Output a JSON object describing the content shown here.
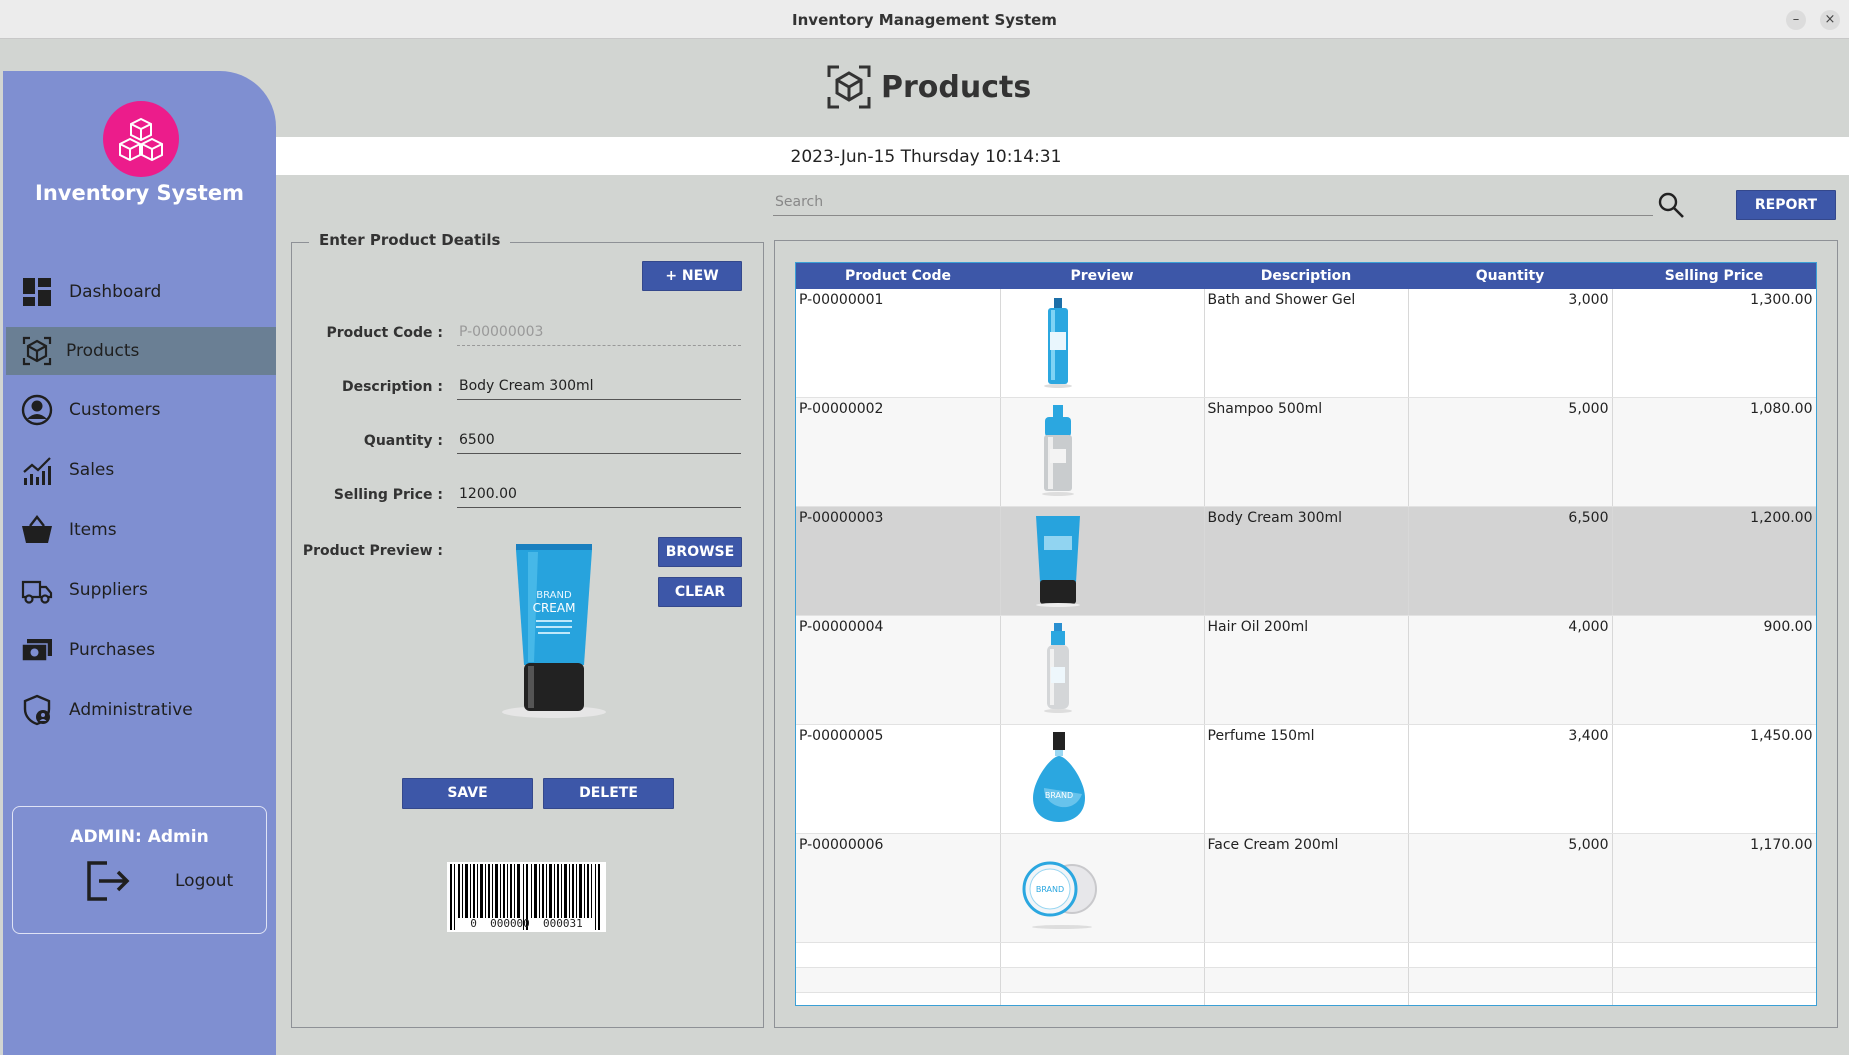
{
  "window": {
    "title": "Inventory Management System",
    "minimize": "–",
    "close": "×"
  },
  "sidebar": {
    "app_title": "Inventory System",
    "items": [
      {
        "label": "Dashboard",
        "icon": "dashboard-icon"
      },
      {
        "label": "Products",
        "icon": "box-icon",
        "active": true
      },
      {
        "label": "Customers",
        "icon": "user-circle-icon"
      },
      {
        "label": "Sales",
        "icon": "chart-icon"
      },
      {
        "label": "Items",
        "icon": "basket-icon"
      },
      {
        "label": "Suppliers",
        "icon": "truck-icon"
      },
      {
        "label": "Purchases",
        "icon": "money-icon"
      },
      {
        "label": "Administrative",
        "icon": "shield-user-icon"
      }
    ],
    "admin_label": "ADMIN: Admin",
    "logout_label": "Logout"
  },
  "header": {
    "title": "Products",
    "datetime": "2023-Jun-15 Thursday 10:14:31"
  },
  "search": {
    "placeholder": "Search"
  },
  "report_button": "REPORT",
  "form": {
    "legend": "Enter Product Deatils",
    "new_button": "+ NEW",
    "product_code_label": "Product Code :",
    "product_code_value": "P-00000003",
    "description_label": "Description :",
    "description_value": "Body Cream 300ml",
    "quantity_label": "Quantity :",
    "quantity_value": "6500",
    "selling_price_label": "Selling Price :",
    "selling_price_value": "1200.00",
    "preview_label": "Product Preview :",
    "browse_button": "BROWSE",
    "clear_button": "CLEAR",
    "save_button": "SAVE",
    "delete_button": "DELETE",
    "barcode_text": "0  000000  000031"
  },
  "table": {
    "headers": [
      "Product Code",
      "Preview",
      "Description",
      "Quantity",
      "Selling Price"
    ],
    "rows": [
      {
        "code": "P-00000001",
        "description": "Bath and Shower Gel",
        "quantity": "3,000",
        "price": "1,300.00",
        "preview": "tall-bottle"
      },
      {
        "code": "P-00000002",
        "description": "Shampoo 500ml",
        "quantity": "5,000",
        "price": "1,080.00",
        "preview": "shampoo-bottle"
      },
      {
        "code": "P-00000003",
        "description": "Body Cream 300ml",
        "quantity": "6,500",
        "price": "1,200.00",
        "preview": "cream-tube",
        "selected": true
      },
      {
        "code": "P-00000004",
        "description": "Hair Oil 200ml",
        "quantity": "4,000",
        "price": "900.00",
        "preview": "oil-bottle"
      },
      {
        "code": "P-00000005",
        "description": "Perfume 150ml",
        "quantity": "3,400",
        "price": "1,450.00",
        "preview": "perfume-bottle"
      },
      {
        "code": "P-00000006",
        "description": "Face Cream 200ml",
        "quantity": "5,000",
        "price": "1,170.00",
        "preview": "cream-jar"
      }
    ]
  },
  "colors": {
    "accent": "#3d57a8",
    "sidebar": "#7f8fd1",
    "logo": "#ec1c8b",
    "selected_row": "#d3d3d3"
  }
}
